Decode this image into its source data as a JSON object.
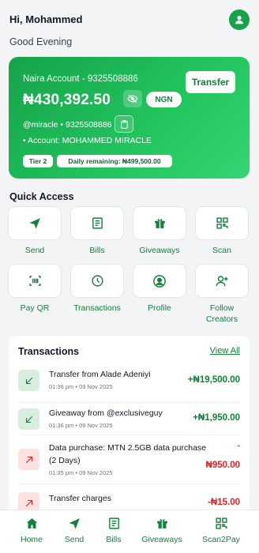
{
  "header": {
    "greeting": "Hi, Mohammed",
    "subtitle": "Good Evening",
    "avatar_icon": "user-icon"
  },
  "account_card": {
    "account_label": "Naira Account - 9325508886",
    "balance": "₦430,392.50",
    "currency": "NGN",
    "transfer_label": "Transfer",
    "handle": "@miracle • 9325508886",
    "owner": "• Account: MOHAMMED MIRACLE",
    "tier": "Tier 2",
    "daily_remaining": "Daily remaining: ₦499,500.00",
    "colors": {
      "gradient_start": "#16a34a",
      "gradient_end": "#34d572"
    }
  },
  "quick_access": {
    "title": "Quick Access",
    "items": [
      {
        "label": "Send",
        "icon": "send-icon"
      },
      {
        "label": "Bills",
        "icon": "bills-icon"
      },
      {
        "label": "Giveaways",
        "icon": "gift-icon"
      },
      {
        "label": "Scan",
        "icon": "qr-scan-icon"
      },
      {
        "label": "Pay QR",
        "icon": "barcode-icon"
      },
      {
        "label": "Transactions",
        "icon": "history-icon"
      },
      {
        "label": "Profile",
        "icon": "profile-icon"
      },
      {
        "label": "Follow Creators",
        "icon": "add-user-icon"
      }
    ]
  },
  "transactions": {
    "title": "Transactions",
    "view_all": "View All",
    "items": [
      {
        "title": "Transfer from Alade Adeniyi",
        "date": "01:36 pm • 09 Nov 2025",
        "amount": "+₦19,500.00",
        "direction": "in"
      },
      {
        "title": "Giveaway from @exclusiveguy",
        "date": "01:36 pm • 09 Nov 2025",
        "amount": "+₦1,950.00",
        "direction": "in"
      },
      {
        "title": "Data purchase: MTN 2.5GB data purchase (2 Days)",
        "date": "01:35 pm • 09 Nov 2025",
        "amount_sign": "-",
        "amount": "₦950.00",
        "direction": "out"
      },
      {
        "title": "Transfer charges",
        "date": "",
        "amount": "-₦15.00",
        "direction": "out"
      }
    ]
  },
  "bottom_nav": {
    "items": [
      {
        "label": "Home",
        "icon": "home-icon"
      },
      {
        "label": "Send",
        "icon": "send-icon"
      },
      {
        "label": "Bills",
        "icon": "bills-icon"
      },
      {
        "label": "Giveaways",
        "icon": "gift-icon"
      },
      {
        "label": "Scan2Pay",
        "icon": "qr-scan-icon"
      }
    ]
  },
  "colors": {
    "accent": "#15803d",
    "positive": "#15803d",
    "negative": "#dc2626",
    "background": "#f3f4f6"
  }
}
